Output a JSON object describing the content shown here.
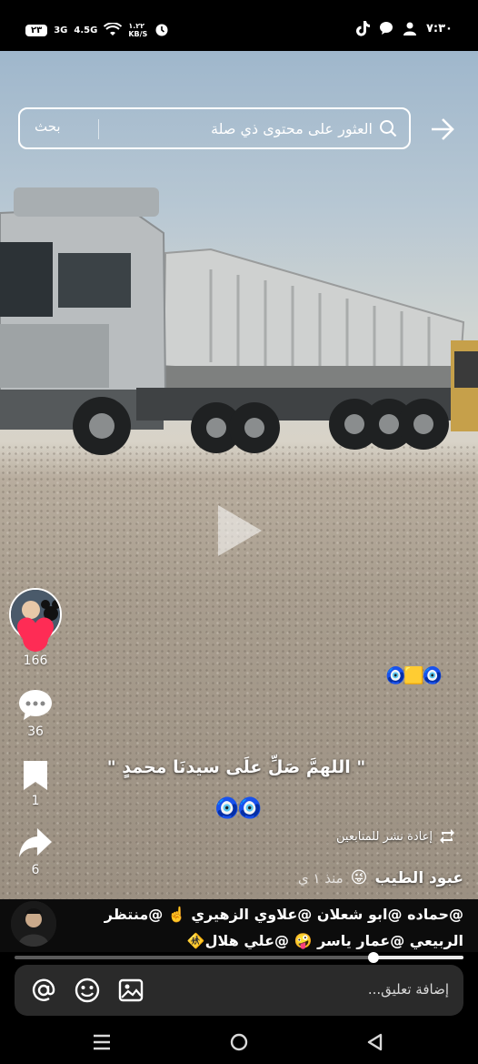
{
  "status_bar": {
    "battery": "٢٣",
    "network_1": "3G",
    "network_2": "4.5G",
    "speed": "١.٢٢ KB/S",
    "time": "٧:٣٠",
    "icons": [
      "signal-icon",
      "wifi-icon",
      "alarm-icon",
      "tiktok-icon",
      "chat-icon",
      "person-icon"
    ]
  },
  "search": {
    "placeholder": "العثور على محتوى ذي صلة",
    "button_label": "بحث"
  },
  "actions": {
    "likes": "166",
    "comments": "36",
    "bookmarks": "1",
    "shares": "6"
  },
  "overlay": {
    "caption": "\" اللهمَّ صَلِّ علَى سيدنَا محمدٍ \"",
    "eyes_small": "🧿🟨🧿",
    "eyes_large": "🧿🧿"
  },
  "repost": {
    "label": "إعادة نشر للمتابعين"
  },
  "author": {
    "name": "عبود الطيب",
    "emoji": "😜",
    "date": "منذ ١ ي"
  },
  "description": {
    "line1": "@حماده @ابو شعلان @علاوي الزهيري ☝️ @منتظر",
    "line2": "الربيعي @عمار ياسر 🤪 @علي هلال🚸"
  },
  "progress": {
    "fraction": 0.2
  },
  "comment_input": {
    "placeholder": "إضافة تعليق..."
  },
  "colors": {
    "like": "#fe2c55",
    "follow": "#fe2c55",
    "background": "#000000"
  }
}
